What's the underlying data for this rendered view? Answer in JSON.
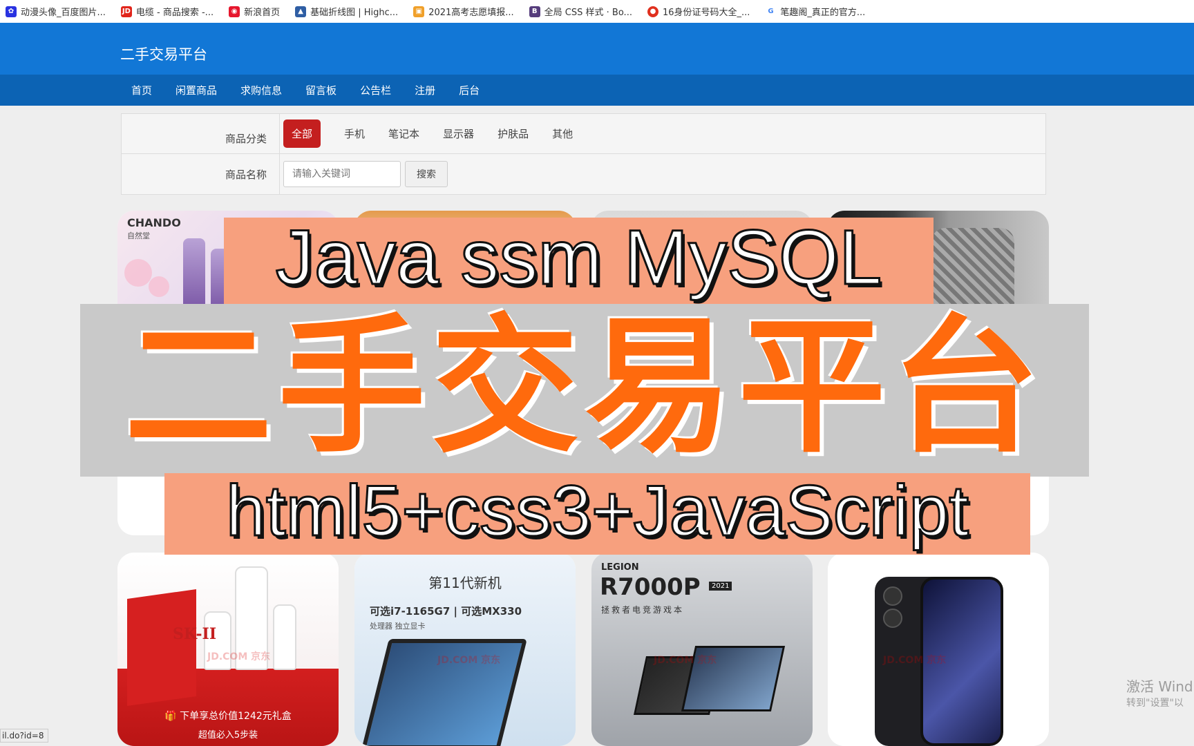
{
  "bookmarks": [
    {
      "label": "动漫头像_百度图片...",
      "icon": "baidu-paw-icon",
      "color": "#2932e1"
    },
    {
      "label": "电缆 - 商品搜索 -...",
      "icon": "jd-icon",
      "color": "#e1251b"
    },
    {
      "label": "新浪首页",
      "icon": "sina-eye-icon",
      "color": "#e6162d"
    },
    {
      "label": "基础折线图 | Highc...",
      "icon": "highcharts-icon",
      "color": "#2f5ea4"
    },
    {
      "label": "2021高考志愿填报...",
      "icon": "folder-icon",
      "color": "#f0a02a"
    },
    {
      "label": "全局 CSS 样式 · Bo...",
      "icon": "bootstrap-icon",
      "color": "#563d7c"
    },
    {
      "label": "16身份证号码大全_...",
      "icon": "red-circle-icon",
      "color": "#e0301e"
    },
    {
      "label": "笔趣阁_真正的官方...",
      "icon": "google-icon",
      "color": "#4285f4"
    }
  ],
  "header": {
    "brand": "二手交易平台",
    "nav": [
      "首页",
      "闲置商品",
      "求购信息",
      "留言板",
      "公告栏",
      "注册",
      "后台"
    ]
  },
  "filter": {
    "category_label": "商品分类",
    "categories": [
      "全部",
      "手机",
      "笔记本",
      "显示器",
      "护肤品",
      "其他"
    ],
    "active_category": "全部",
    "name_label": "商品名称",
    "search_placeholder": "请输入关键词",
    "search_button": "搜索"
  },
  "products_row1": {
    "card1_brand": "CHANDO",
    "card1_sub": "自然堂"
  },
  "products_row2": {
    "sk2_brand": "SK-II",
    "sk2_promo": "🎁 下单享总价值1242元礼盒",
    "sk2_promo2": "超值必入5步装",
    "laptop_title": "第11代新机",
    "laptop_specs": "可选i7-1165G7 | 可选MX330",
    "laptop_specs_sub": "处理器              独立显卡",
    "legion_brand": "LEGION",
    "legion_model": "R7000P",
    "legion_year": "2021",
    "legion_sub": "拯救者电竞游戏本",
    "watermark": "JD.COM 京东"
  },
  "overlay": {
    "line1": "Java ssm MySQL",
    "line2": "二手交易平台",
    "line3": "html5+css3+JavaScript"
  },
  "system": {
    "activation_line1": "激活 Wind",
    "activation_line2": "转到\"设置\"以",
    "status_url": "il.do?id=8"
  },
  "colors": {
    "header_blue": "#1277d6",
    "nav_blue": "#0c63b4",
    "active_red": "#c41f1f",
    "title_orange": "#ff6a0d",
    "banner_salmon": "#f7a07e"
  }
}
